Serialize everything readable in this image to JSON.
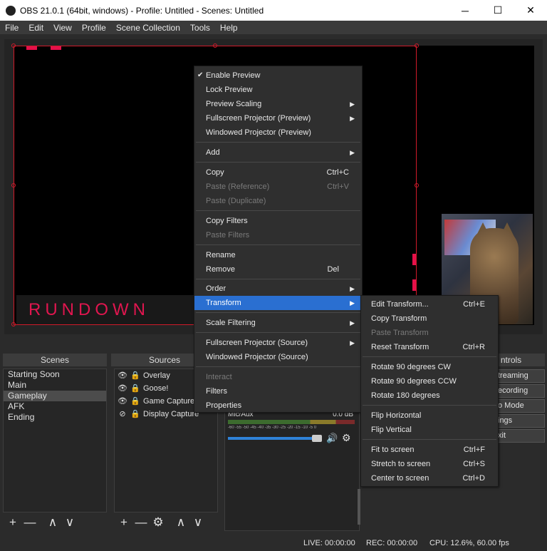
{
  "window": {
    "title": "OBS 21.0.1 (64bit, windows) - Profile: Untitled - Scenes: Untitled",
    "minimize": "─",
    "maximize": "☐",
    "close": "✕"
  },
  "menubar": [
    "File",
    "Edit",
    "View",
    "Profile",
    "Scene Collection",
    "Tools",
    "Help"
  ],
  "preview": {
    "overlay_text": "RUNDOWN"
  },
  "docks": {
    "scenes_title": "Scenes",
    "sources_title": "Sources",
    "controls_title": "ntrols",
    "scenes": [
      "Starting Soon",
      "Main",
      "Gameplay",
      "AFK",
      "Ending"
    ],
    "selected_scene": "Gameplay",
    "sources": [
      {
        "label": "Overlay",
        "eye": "👁",
        "lock": "🔒"
      },
      {
        "label": "Goose!",
        "eye": "👁",
        "lock": "🔒"
      },
      {
        "label": "Game Capture",
        "eye": "👁",
        "lock": "🔒"
      },
      {
        "label": "Display Capture",
        "eye": "⊘",
        "lock": "🔒"
      }
    ],
    "toolbar_icons": {
      "add": "+",
      "remove": "—",
      "up": "∧",
      "down": "∨",
      "settings": "⚙"
    },
    "controls": [
      "treaming",
      "ecording",
      "o Mode",
      "ings",
      "xit"
    ],
    "mixer": {
      "source": "Mic/Aux",
      "level": "0.0 dB",
      "ticks": "-60 -55 -50 -45 -40 -35 -30 -25 -20 -15 -10 -5 0"
    }
  },
  "status": {
    "live": "LIVE: 00:00:00",
    "rec": "REC: 00:00:00",
    "cpu": "CPU: 12.6%, 60.00 fps"
  },
  "context_menu": {
    "enable_preview": "Enable Preview",
    "check": "✔",
    "lock_preview": "Lock Preview",
    "preview_scaling": "Preview Scaling",
    "fullscreen_projector_preview": "Fullscreen Projector (Preview)",
    "windowed_projector_preview": "Windowed Projector (Preview)",
    "add": "Add",
    "copy": "Copy",
    "copy_sc": "Ctrl+C",
    "paste_ref": "Paste (Reference)",
    "paste_ref_sc": "Ctrl+V",
    "paste_dup": "Paste (Duplicate)",
    "copy_filters": "Copy Filters",
    "paste_filters": "Paste Filters",
    "rename": "Rename",
    "remove": "Remove",
    "remove_sc": "Del",
    "order": "Order",
    "transform": "Transform",
    "scale_filtering": "Scale Filtering",
    "fullscreen_projector_source": "Fullscreen Projector (Source)",
    "windowed_projector_source": "Windowed Projector (Source)",
    "interact": "Interact",
    "filters": "Filters",
    "properties": "Properties",
    "arrow": "▶"
  },
  "transform_menu": {
    "edit": "Edit Transform...",
    "edit_sc": "Ctrl+E",
    "copy": "Copy Transform",
    "paste": "Paste Transform",
    "reset": "Reset Transform",
    "reset_sc": "Ctrl+R",
    "rot_cw": "Rotate 90 degrees CW",
    "rot_ccw": "Rotate 90 degrees CCW",
    "rot_180": "Rotate 180 degrees",
    "flip_h": "Flip Horizontal",
    "flip_v": "Flip Vertical",
    "fit": "Fit to screen",
    "fit_sc": "Ctrl+F",
    "stretch": "Stretch to screen",
    "stretch_sc": "Ctrl+S",
    "center": "Center to screen",
    "center_sc": "Ctrl+D"
  }
}
